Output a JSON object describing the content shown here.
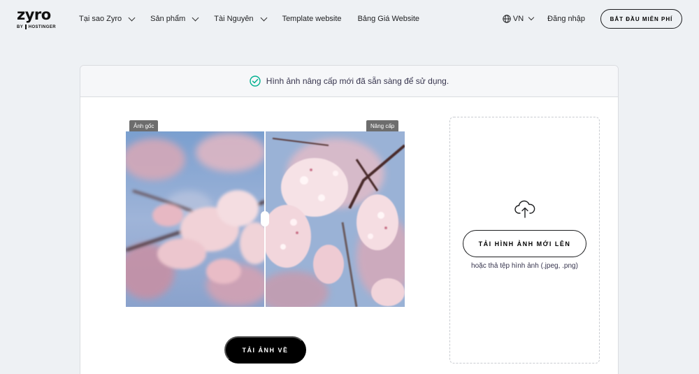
{
  "brand": {
    "name": "zyro",
    "byline": "BY",
    "parent": "HOSTINGER"
  },
  "nav": {
    "items": [
      {
        "label": "Tại sao Zyro",
        "dropdown": true
      },
      {
        "label": "Sản phẩm",
        "dropdown": true
      },
      {
        "label": "Tài Nguyên",
        "dropdown": true
      },
      {
        "label": "Template website",
        "dropdown": false
      },
      {
        "label": "Bảng Giá Website",
        "dropdown": false
      }
    ],
    "language": "VN",
    "login": "Đăng nhập",
    "cta": "BẮT ĐẦU MIỄN PHÍ"
  },
  "banner": {
    "message": "Hình ảnh nâng cấp mới đã sẵn sàng để sử dụng.",
    "icon": "check-circle-icon"
  },
  "compare": {
    "original_label": "Ảnh gốc",
    "enhanced_label": "Nâng cấp"
  },
  "download": {
    "label": "TẢI ẢNH VỀ"
  },
  "upload": {
    "button_label": "TẢI HÌNH ẢNH MỚI LÊN",
    "hint": "hoặc thả tệp hình ảnh (.jpeg, .png)",
    "icon": "cloud-upload-icon"
  },
  "colors": {
    "background": "#eef1f4",
    "accent_green": "#00b090",
    "dark": "#1d1e20"
  }
}
